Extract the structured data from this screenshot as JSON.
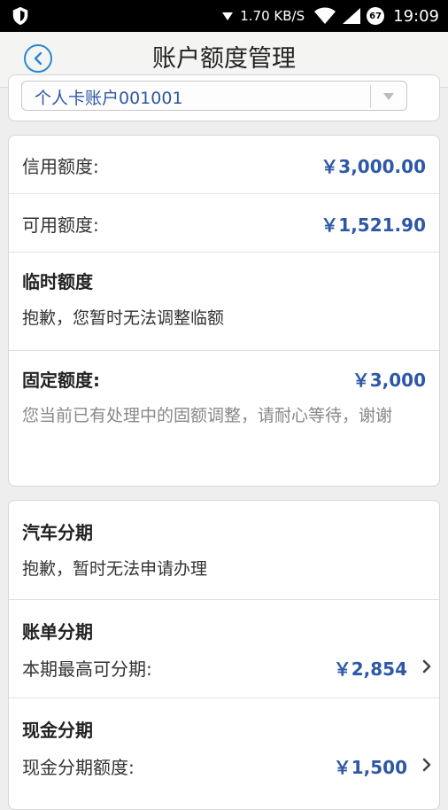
{
  "status_bar": {
    "network_speed": "1.70 KB/S",
    "battery_badge": "67",
    "time": "19:09"
  },
  "header": {
    "title": "账户额度管理"
  },
  "account_selector": {
    "value": "个人卡账户001001"
  },
  "limits": {
    "credit_label": "信用额度:",
    "credit_value": "￥3,000.00",
    "available_label": "可用额度:",
    "available_value": "￥1,521.90",
    "temporary_title": "临时额度",
    "temporary_note": "抱歉，您暂时无法调整临额",
    "fixed_title": "固定额度:",
    "fixed_value": "￥3,000",
    "fixed_note": "您当前已有处理中的固额调整，请耐心等待，谢谢"
  },
  "installments": {
    "car_title": "汽车分期",
    "car_note": "抱歉，暂时无法申请办理",
    "bill_title": "账单分期",
    "bill_label": "本期最高可分期:",
    "bill_value": "￥2,854",
    "cash_title": "现金分期",
    "cash_label": "现金分期额度:",
    "cash_value": "￥1,500"
  },
  "colors": {
    "accent_blue": "#2a86d5",
    "amount_blue": "#2d58a6",
    "background": "#eeeeee"
  }
}
